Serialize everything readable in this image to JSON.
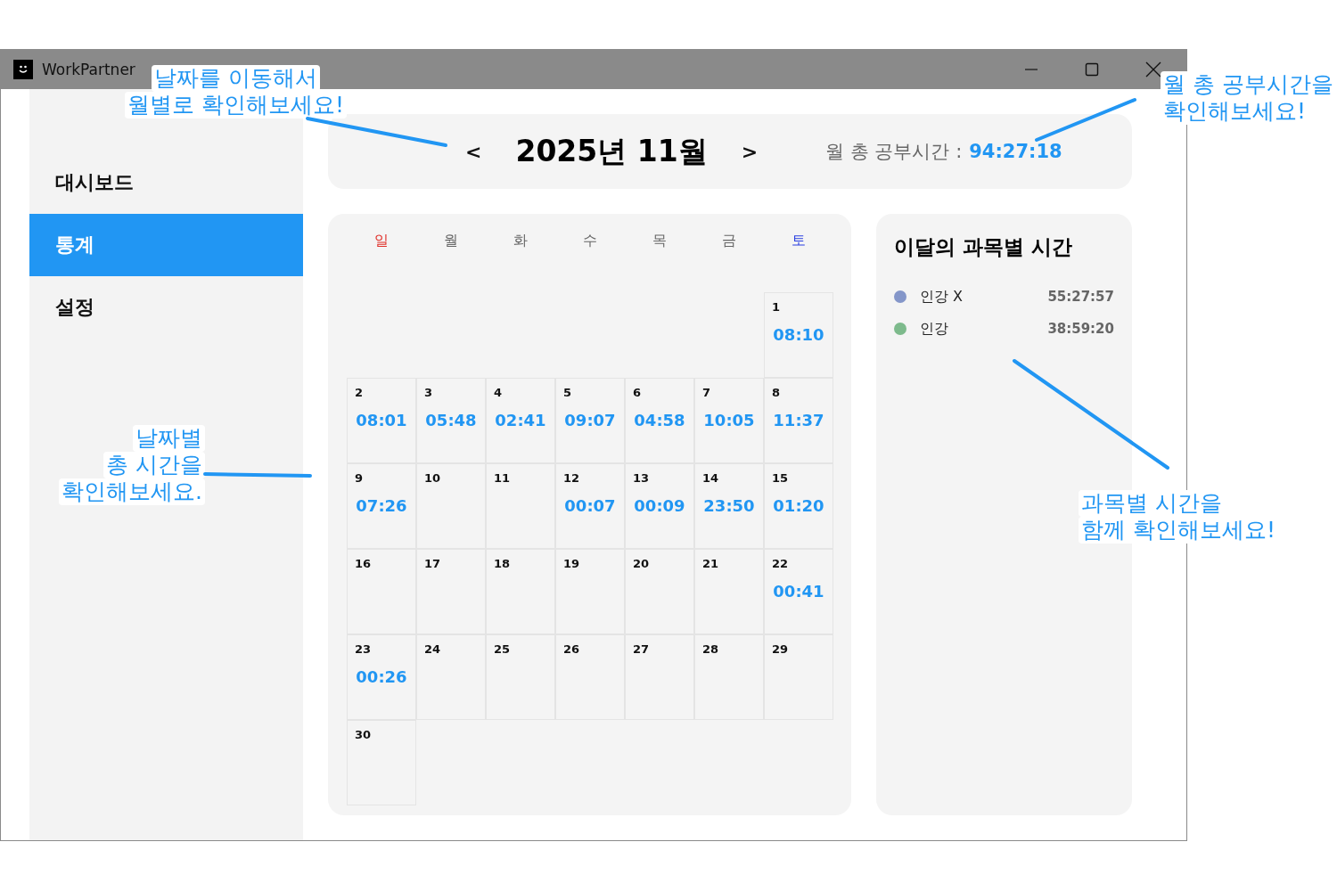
{
  "window": {
    "title": "WorkPartner"
  },
  "sidebar": {
    "items": [
      {
        "label": "대시보드",
        "selected": false
      },
      {
        "label": "통계",
        "selected": true
      },
      {
        "label": "설정",
        "selected": false
      }
    ]
  },
  "header": {
    "prev": "<",
    "title": "2025년 11월",
    "next": ">",
    "total_label": "월 총 공부시간 :",
    "total_value": "94:27:18"
  },
  "calendar": {
    "weekdays": [
      {
        "label": "일",
        "kind": "sunday"
      },
      {
        "label": "월",
        "kind": "weekday"
      },
      {
        "label": "화",
        "kind": "weekday"
      },
      {
        "label": "수",
        "kind": "weekday"
      },
      {
        "label": "목",
        "kind": "weekday"
      },
      {
        "label": "금",
        "kind": "weekday"
      },
      {
        "label": "토",
        "kind": "saturday"
      }
    ],
    "weeks": [
      [
        {
          "day": "1",
          "time": "08:10"
        }
      ],
      [
        {
          "day": "2",
          "time": "08:01"
        },
        {
          "day": "3",
          "time": "05:48"
        },
        {
          "day": "4",
          "time": "02:41"
        },
        {
          "day": "5",
          "time": "09:07"
        },
        {
          "day": "6",
          "time": "04:58"
        },
        {
          "day": "7",
          "time": "10:05"
        },
        {
          "day": "8",
          "time": "11:37"
        }
      ],
      [
        {
          "day": "9",
          "time": "07:26"
        },
        {
          "day": "10"
        },
        {
          "day": "11"
        },
        {
          "day": "12",
          "time": "00:07"
        },
        {
          "day": "13",
          "time": "00:09"
        },
        {
          "day": "14",
          "time": "23:50"
        },
        {
          "day": "15",
          "time": "01:20"
        }
      ],
      [
        {
          "day": "16"
        },
        {
          "day": "17"
        },
        {
          "day": "18"
        },
        {
          "day": "19"
        },
        {
          "day": "20"
        },
        {
          "day": "21"
        },
        {
          "day": "22",
          "time": "00:41"
        }
      ],
      [
        {
          "day": "23",
          "time": "00:26"
        },
        {
          "day": "24"
        },
        {
          "day": "25"
        },
        {
          "day": "26"
        },
        {
          "day": "27"
        },
        {
          "day": "28"
        },
        {
          "day": "29"
        }
      ],
      [
        {
          "day": "30"
        }
      ]
    ]
  },
  "subjects": {
    "title": "이달의 과목별 시간",
    "items": [
      {
        "name": "인강 X",
        "time": "55:27:57",
        "color": "#8496c9"
      },
      {
        "name": "인강",
        "time": "38:59:20",
        "color": "#7dba8c"
      }
    ]
  },
  "annotations": [
    {
      "lines": [
        "날짜를 이동해서",
        "월별로 확인해보세요!"
      ]
    },
    {
      "lines": [
        "월 총 공부시간을",
        "확인해보세요!"
      ]
    },
    {
      "lines": [
        "날짜별",
        "총 시간을",
        "확인해보세요."
      ]
    },
    {
      "lines": [
        "과목별 시간을",
        "함께 확인해보세요!"
      ]
    }
  ]
}
